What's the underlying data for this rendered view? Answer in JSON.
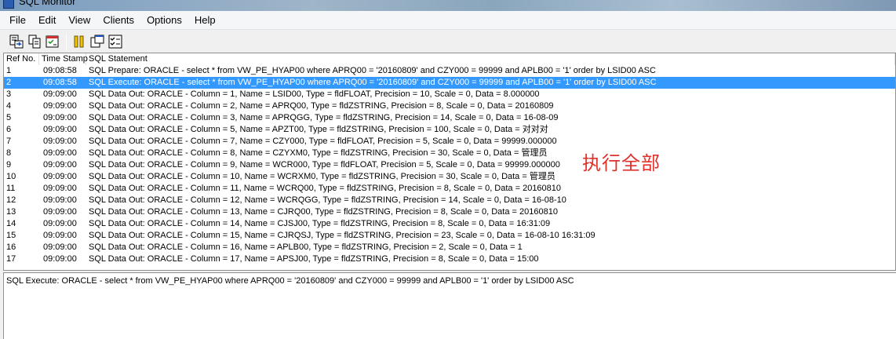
{
  "window": {
    "title": "SQL Monitor"
  },
  "menu": [
    "File",
    "Edit",
    "View",
    "Clients",
    "Options",
    "Help"
  ],
  "toolbar": {
    "icons": [
      "export-icon",
      "copy-icon",
      "properties-icon",
      "pause-icon",
      "clear-icon",
      "checklist-icon"
    ]
  },
  "table": {
    "headers": {
      "ref": "Ref No.",
      "time": "Time Stamp",
      "sql": "SQL Statement"
    },
    "rows": [
      {
        "ref": "1",
        "time": "09:08:58",
        "sql": "SQL Prepare: ORACLE - select * from VW_PE_HYAP00 where APRQ00 = '20160809' and CZY000 = 99999 and APLB00 = '1'  order by LSID00 ASC"
      },
      {
        "ref": "2",
        "time": "09:08:58",
        "sql": "SQL Execute: ORACLE - select * from VW_PE_HYAP00 where APRQ00 = '20160809' and CZY000 = 99999 and APLB00 = '1'  order by LSID00 ASC"
      },
      {
        "ref": "3",
        "time": "09:09:00",
        "sql": "SQL Data Out: ORACLE - Column = 1, Name = LSID00, Type = fldFLOAT, Precision = 10, Scale = 0, Data = 8.000000"
      },
      {
        "ref": "4",
        "time": "09:09:00",
        "sql": "SQL Data Out: ORACLE - Column = 2, Name = APRQ00, Type = fldZSTRING, Precision = 8, Scale = 0, Data = 20160809"
      },
      {
        "ref": "5",
        "time": "09:09:00",
        "sql": "SQL Data Out: ORACLE - Column = 3, Name = APRQGG, Type = fldZSTRING, Precision = 14, Scale = 0, Data = 16-08-09"
      },
      {
        "ref": "6",
        "time": "09:09:00",
        "sql": "SQL Data Out: ORACLE - Column = 5, Name = APZT00, Type = fldZSTRING, Precision = 100, Scale = 0, Data = 对对对"
      },
      {
        "ref": "7",
        "time": "09:09:00",
        "sql": "SQL Data Out: ORACLE - Column = 7, Name = CZY000, Type = fldFLOAT, Precision = 5, Scale = 0, Data = 99999.000000"
      },
      {
        "ref": "8",
        "time": "09:09:00",
        "sql": "SQL Data Out: ORACLE - Column = 8, Name = CZYXM0, Type = fldZSTRING, Precision = 30, Scale = 0, Data = 管理员"
      },
      {
        "ref": "9",
        "time": "09:09:00",
        "sql": "SQL Data Out: ORACLE - Column = 9, Name = WCR000, Type = fldFLOAT, Precision = 5, Scale = 0, Data = 99999.000000"
      },
      {
        "ref": "10",
        "time": "09:09:00",
        "sql": "SQL Data Out: ORACLE - Column = 10, Name = WCRXM0, Type = fldZSTRING, Precision = 30, Scale = 0, Data = 管理员"
      },
      {
        "ref": "11",
        "time": "09:09:00",
        "sql": "SQL Data Out: ORACLE - Column = 11, Name = WCRQ00, Type = fldZSTRING, Precision = 8, Scale = 0, Data = 20160810"
      },
      {
        "ref": "12",
        "time": "09:09:00",
        "sql": "SQL Data Out: ORACLE - Column = 12, Name = WCRQGG, Type = fldZSTRING, Precision = 14, Scale = 0, Data = 16-08-10"
      },
      {
        "ref": "13",
        "time": "09:09:00",
        "sql": "SQL Data Out: ORACLE - Column = 13, Name = CJRQ00, Type = fldZSTRING, Precision = 8, Scale = 0, Data = 20160810"
      },
      {
        "ref": "14",
        "time": "09:09:00",
        "sql": "SQL Data Out: ORACLE - Column = 14, Name = CJSJ00, Type = fldZSTRING, Precision = 8, Scale = 0, Data = 16:31:09"
      },
      {
        "ref": "15",
        "time": "09:09:00",
        "sql": "SQL Data Out: ORACLE - Column = 15, Name = CJRQSJ, Type = fldZSTRING, Precision = 23, Scale = 0, Data = 16-08-10 16:31:09"
      },
      {
        "ref": "16",
        "time": "09:09:00",
        "sql": "SQL Data Out: ORACLE - Column = 16, Name = APLB00, Type = fldZSTRING, Precision = 2, Scale = 0, Data = 1"
      },
      {
        "ref": "17",
        "time": "09:09:00",
        "sql": "SQL Data Out: ORACLE - Column = 17, Name = APSJ00, Type = fldZSTRING, Precision = 8, Scale = 0, Data = 15:00"
      }
    ],
    "selected_index": 1
  },
  "detail": {
    "text": "SQL Execute: ORACLE - select * from VW_PE_HYAP00 where APRQ00 = '20160809' and CZY000 = 99999 and APLB00 = '1'  order by LSID00 ASC"
  },
  "annotation": {
    "text": "执行全部",
    "color": "#e0312a"
  }
}
